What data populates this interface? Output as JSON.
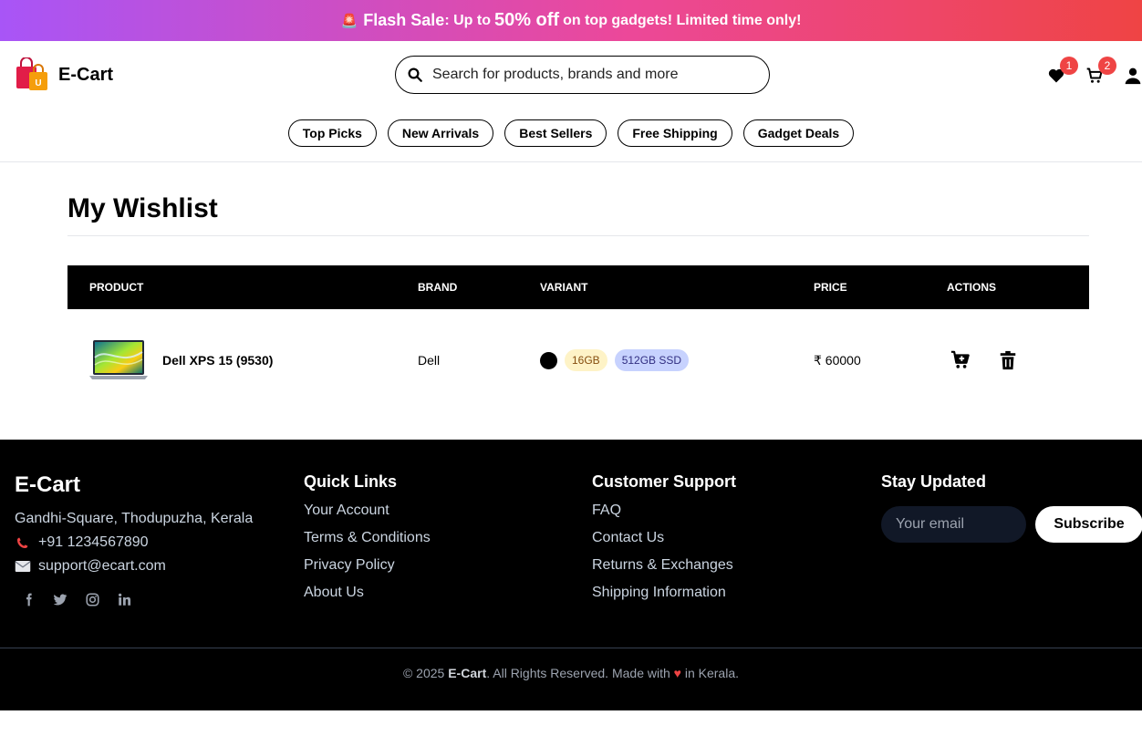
{
  "flash": {
    "siren": "🚨",
    "label": "Flash Sale",
    "prefix": ": Up to",
    "percent": "50% off",
    "suffix": "on top gadgets! Limited time only!"
  },
  "header": {
    "logo_text": "E-Cart",
    "search_placeholder": "Search for products, brands and more",
    "wishlist_count": "1",
    "cart_count": "2"
  },
  "categories": [
    "Top Picks",
    "New Arrivals",
    "Best Sellers",
    "Free Shipping",
    "Gadget Deals"
  ],
  "wishlist": {
    "title": "My Wishlist",
    "columns": [
      "Product",
      "Brand",
      "Variant",
      "Price",
      "Actions"
    ],
    "items": [
      {
        "name": "Dell XPS 15 (9530)",
        "brand": "Dell",
        "color": "#000000",
        "ram": "16GB",
        "storage": "512GB SSD",
        "price": "₹ 60000"
      }
    ]
  },
  "footer": {
    "brand": "E-Cart",
    "address": "Gandhi-Square, Thodupuzha, Kerala",
    "phone": "+91 1234567890",
    "email": "support@ecart.com",
    "quick_links_title": "Quick Links",
    "quick_links": [
      "Your Account",
      "Terms & Conditions",
      "Privacy Policy",
      "About Us"
    ],
    "support_title": "Customer Support",
    "support_links": [
      "FAQ",
      "Contact Us",
      "Returns & Exchanges",
      "Shipping Information"
    ],
    "newsletter_title": "Stay Updated",
    "newsletter_placeholder": "Your email",
    "subscribe_label": "Subscribe",
    "copyright_prefix": "© 2025",
    "copyright_brand": "E-Cart",
    "copyright_mid": ". All Rights Reserved. Made with",
    "copyright_heart": "♥",
    "copyright_suffix": "in Kerala."
  },
  "colors": {
    "accent": "#ef4444",
    "banner_start": "#a855f7",
    "banner_end": "#ef4444"
  }
}
